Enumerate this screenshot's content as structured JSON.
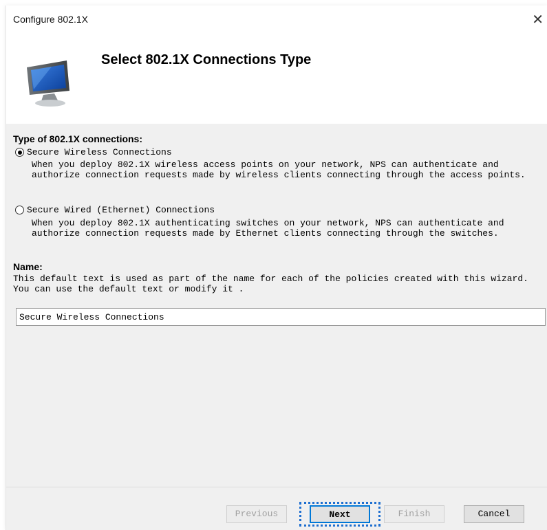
{
  "window": {
    "title": "Configure 802.1X",
    "close_glyph": "✕"
  },
  "header": {
    "heading": "Select 802.1X Connections Type",
    "icon": "monitor-icon"
  },
  "connections": {
    "label": "Type of 802.1X connections:",
    "options": [
      {
        "label": "Secure Wireless Connections",
        "checked": true,
        "description": "When you deploy 802.1X wireless access points on your network, NPS can authenticate and authorize connection requests made by wireless clients connecting through the access points."
      },
      {
        "label": "Secure Wired (Ethernet) Connections",
        "checked": false,
        "description": "When you deploy 802.1X authenticating switches on your network, NPS can authenticate and authorize connection requests made by Ethernet clients connecting through the switches."
      }
    ]
  },
  "name": {
    "label": "Name:",
    "description": "This default text is used as part of the name for each of the policies created with this wizard. You can use the default text or modify it .",
    "value": "Secure Wireless Connections"
  },
  "footer": {
    "previous": "Previous",
    "next": "Next",
    "finish": "Finish",
    "cancel": "Cancel"
  }
}
